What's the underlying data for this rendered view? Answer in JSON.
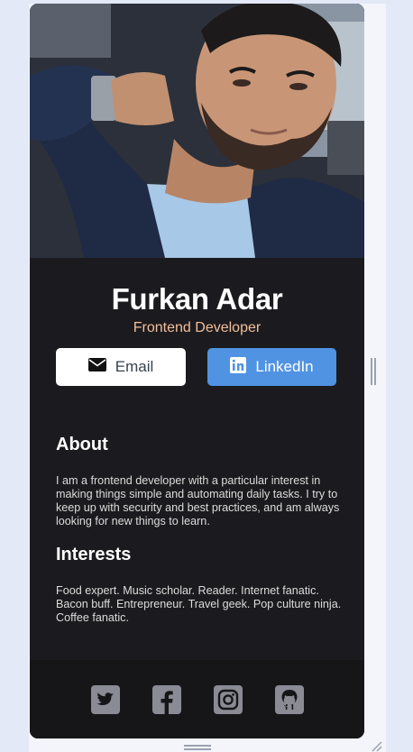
{
  "profile": {
    "name": "Furkan Adar",
    "role": "Frontend Developer",
    "photo_icon": "profile-photo"
  },
  "buttons": {
    "email_label": "Email",
    "email_icon": "envelope-icon",
    "linkedin_label": "LinkedIn",
    "linkedin_icon": "linkedin-icon"
  },
  "about": {
    "heading": "About",
    "text": "I am a frontend developer with a particular interest in making things simple and automating daily tasks. I try to keep up with security and best practices, and am always looking for new things to learn."
  },
  "interests": {
    "heading": "Interests",
    "text": "Food expert. Music scholar. Reader. Internet fanatic. Bacon buff. Entrepreneur. Travel geek. Pop culture ninja. Coffee fanatic."
  },
  "footer": {
    "socials": [
      "twitter-icon",
      "facebook-icon",
      "instagram-icon",
      "github-icon"
    ]
  },
  "colors": {
    "card_bg": "#1b1b1f",
    "footer_bg": "#161619",
    "accent_role": "#f3bf99",
    "linkedin_blue": "#5093e2",
    "page_bg": "#e3e9f6"
  }
}
